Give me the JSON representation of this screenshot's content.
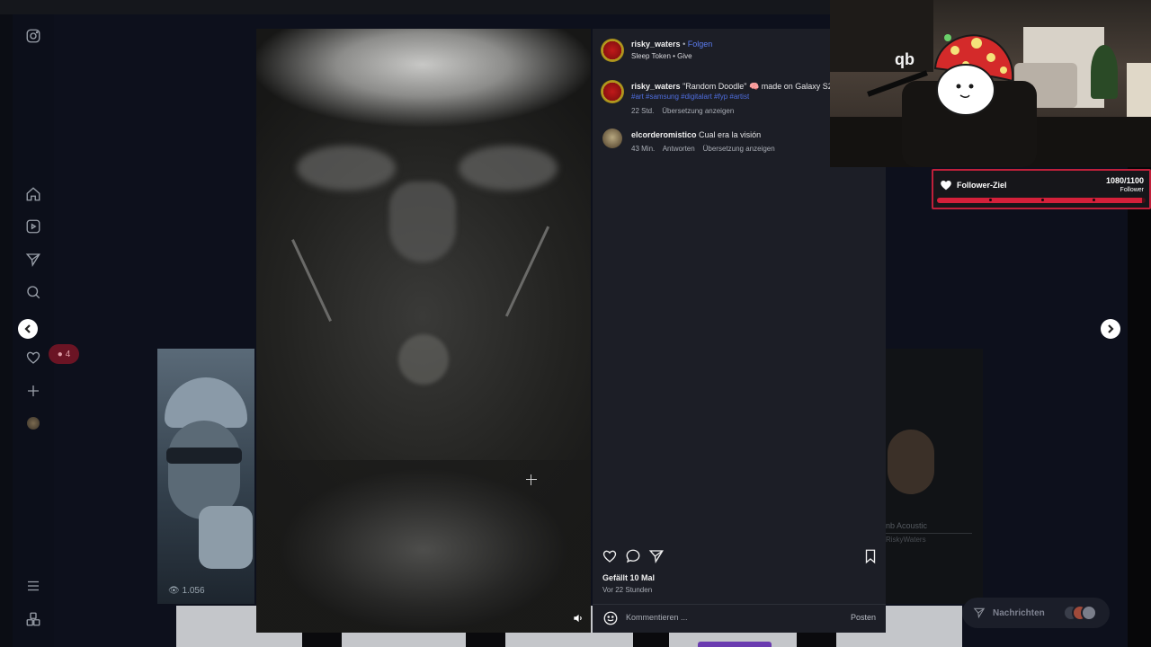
{
  "colors": {
    "background": "#0b0d14",
    "panel": "#1c1e26",
    "link_blue": "#5b7cf0",
    "goal_red": "#c0203a"
  },
  "sidebar": {
    "items": [
      {
        "name": "instagram-logo-icon"
      },
      {
        "name": "home-icon"
      },
      {
        "name": "reels-icon"
      },
      {
        "name": "explore-icon"
      },
      {
        "name": "search-icon"
      },
      {
        "name": "heart-icon"
      },
      {
        "name": "create-icon"
      },
      {
        "name": "profile-icon"
      },
      {
        "name": "menu-icon"
      },
      {
        "name": "more-apps-icon"
      }
    ],
    "notification_count": "4"
  },
  "background_cards": {
    "left_views": "1.056",
    "right_title": "nb Acoustic",
    "right_subtitle": "RiskyWaters"
  },
  "post": {
    "author": "risky_waters",
    "separator": "•",
    "follow_label": "Folgen",
    "audio": "Sleep Token • Give",
    "caption_user": "risky_waters",
    "caption_text": "\"Random Doodle\" 🧠 made on Galaxy S2",
    "hashtags": "#art #samsung #digitalart #fyp #artist",
    "caption_age": "22 Std.",
    "caption_translate": "Übersetzung anzeigen",
    "comments": [
      {
        "user": "elcorderomistico",
        "text": "Cual era la visión",
        "age": "43 Min.",
        "reply": "Antworten",
        "translate": "Übersetzung anzeigen"
      }
    ],
    "likes": "Gefällt 10 Mal",
    "posted": "Vor 22 Stunden",
    "comment_placeholder": "Kommentieren ...",
    "post_button": "Posten"
  },
  "stream_overlay": {
    "webcam_logo": "qb",
    "goal_title": "Follower-Ziel",
    "goal_count": "1080/1100",
    "goal_unit": "Follower",
    "goal_progress": 0.982
  },
  "messages": {
    "label": "Nachrichten"
  }
}
